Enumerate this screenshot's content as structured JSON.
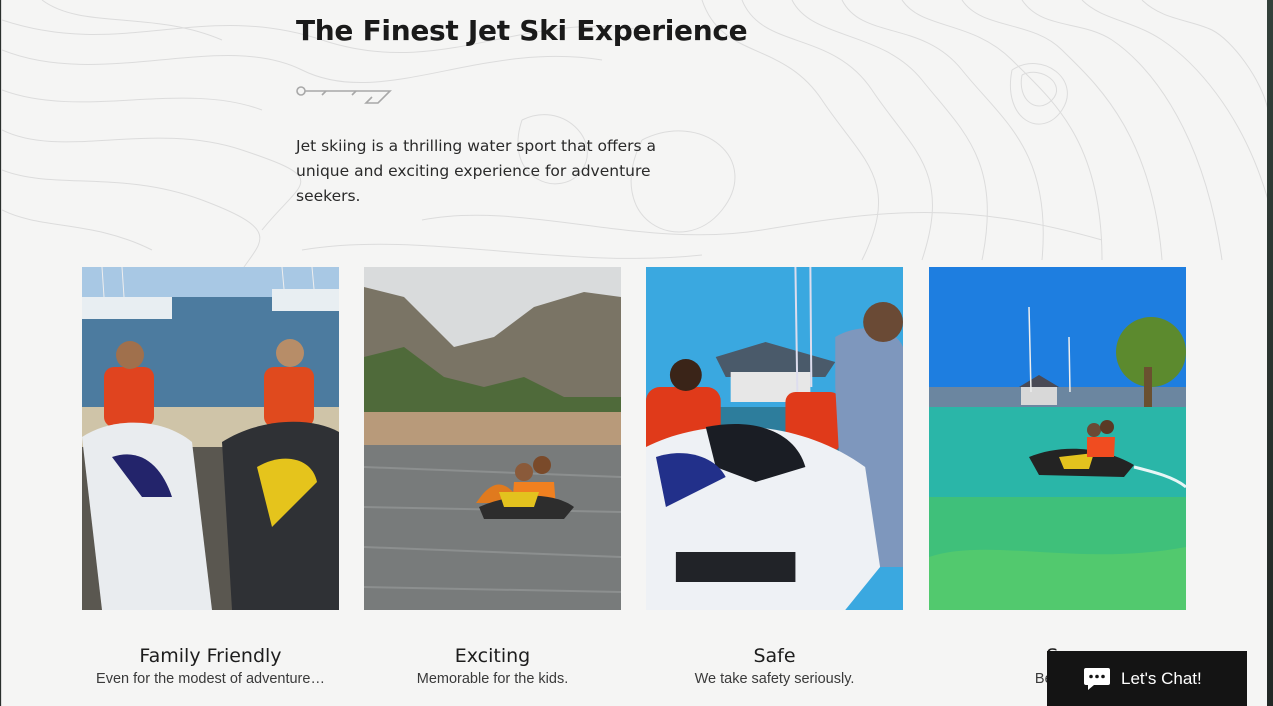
{
  "section": {
    "title": "The Finest Jet Ski Experience",
    "intro": "Jet skiing is a thrilling water sport that offers a unique and exciting experience for adventure seekers."
  },
  "cards": [
    {
      "title": "Family Friendly",
      "desc": "Even for the modest of adventure…",
      "image": "couple-on-jet-skis-at-marina"
    },
    {
      "title": "Exciting",
      "desc": "Memorable for the kids.",
      "image": "jet-ski-on-lake-with-mountains"
    },
    {
      "title": "Safe",
      "desc": "We take safety seriously.",
      "image": "instructor-briefing-riders"
    },
    {
      "title": "Sc",
      "desc": "Beautif",
      "image": "jet-ski-in-turquoise-harbour"
    }
  ],
  "chat": {
    "label": "Let's Chat!",
    "icon": "chat-bubble-icon"
  },
  "colors": {
    "background": "#f5f5f4",
    "text": "#1a1a1a",
    "chat_bg": "#141414"
  }
}
